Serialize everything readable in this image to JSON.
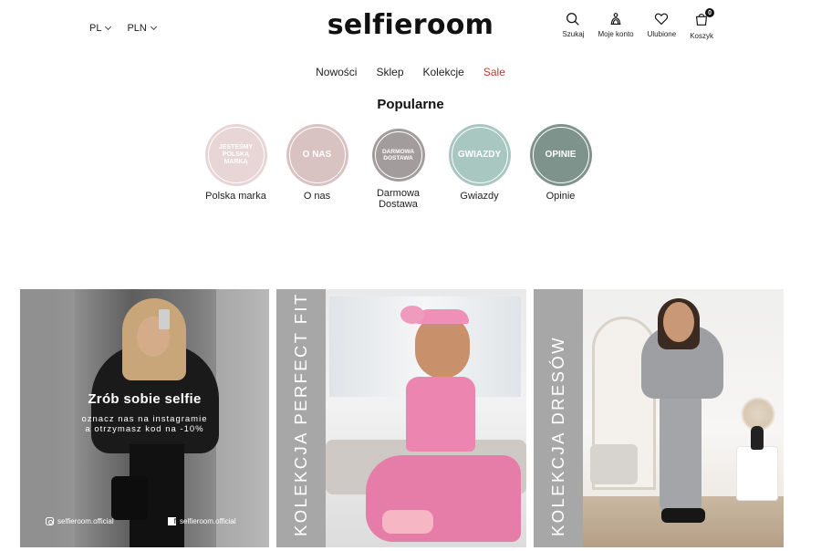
{
  "header": {
    "language": "PL",
    "currency": "PLN",
    "logo": "selfieroom",
    "actions": [
      {
        "label": "Szukaj",
        "icon": "search-icon"
      },
      {
        "label": "Moje konto",
        "icon": "account-icon"
      },
      {
        "label": "Ulubione",
        "icon": "heart-icon"
      },
      {
        "label": "Koszyk",
        "icon": "cart-icon"
      }
    ],
    "cart_count": "0"
  },
  "nav": {
    "items": [
      "Nowości",
      "Sklep",
      "Kolekcje",
      "Sale"
    ]
  },
  "popular": {
    "title": "Popularne",
    "items": [
      {
        "badge": "JESTEŚMY POLSKĄ MARKĄ",
        "label": "Polska marka",
        "color": "#e8d5d5"
      },
      {
        "badge": "O NAS",
        "label": "O nas",
        "color": "#d9c2c2"
      },
      {
        "badge": "DARMOWA DOSTAWA",
        "label": "Darmowa Dostawa",
        "color": "#a39c9c"
      },
      {
        "badge": "GWIAZDY",
        "label": "Gwiazdy",
        "color": "#a9c7c1"
      },
      {
        "badge": "OPINIE",
        "label": "Opinie",
        "color": "#7f938d"
      }
    ]
  },
  "banners": {
    "selfie": {
      "title": "Zrób sobie selfie",
      "subtitle_line1": "oznacz nas na instagramie",
      "subtitle_line2": "a otrzymasz kod na -10%",
      "instagram": "selfieroom.official",
      "facebook": "selfieroom.official"
    },
    "perfect_fit": {
      "label": "KOLEKCJA PERFECT FIT"
    },
    "dresy": {
      "label": "KOLEKCJA DRESÓW"
    }
  }
}
